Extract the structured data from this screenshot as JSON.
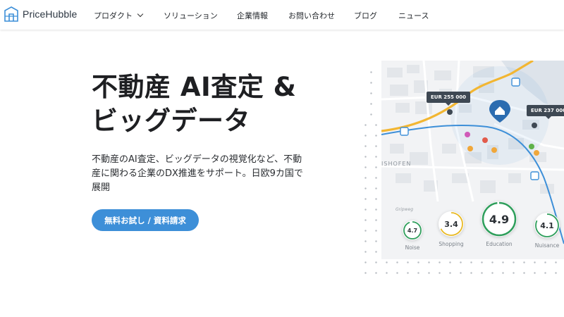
{
  "brand": {
    "name": "PriceHubble"
  },
  "nav": {
    "items": [
      {
        "label": "プロダクト",
        "has_dropdown": true
      },
      {
        "label": "ソリューション"
      },
      {
        "label": "企業情報"
      },
      {
        "label": "お問い合わせ"
      },
      {
        "label": "ブログ"
      },
      {
        "label": "ニュース"
      }
    ]
  },
  "hero": {
    "title_line1": "不動産 AI査定 &",
    "title_line2": "ビッグデータ",
    "description": "不動産のAI査定、ビッグデータの視覚化など、不動産に関わる企業のDX推進をサポート。日欧9カ国で展開",
    "cta_label": "無料お試し / 資料請求"
  },
  "map": {
    "price_tags": [
      "EUR 255 000",
      "EUR 237 000"
    ],
    "place_label": "ISHOFEN",
    "small_label": "Gripweg",
    "scores": [
      {
        "label": "Noise",
        "value": "4.7",
        "color": "#2e9e5b",
        "fraction": 0.94
      },
      {
        "label": "Shopping",
        "value": "3.4",
        "color": "#e8b923",
        "fraction": 0.68
      },
      {
        "label": "Education",
        "value": "4.9",
        "color": "#2e9e5b",
        "fraction": 0.98
      },
      {
        "label": "Nuisance",
        "value": "4.1",
        "color": "#2e9e5b",
        "fraction": 0.82
      }
    ],
    "colors": {
      "road_yellow": "#f2b632",
      "route_blue": "#3d8fd8",
      "marker_blue": "#2b6cb0"
    }
  }
}
